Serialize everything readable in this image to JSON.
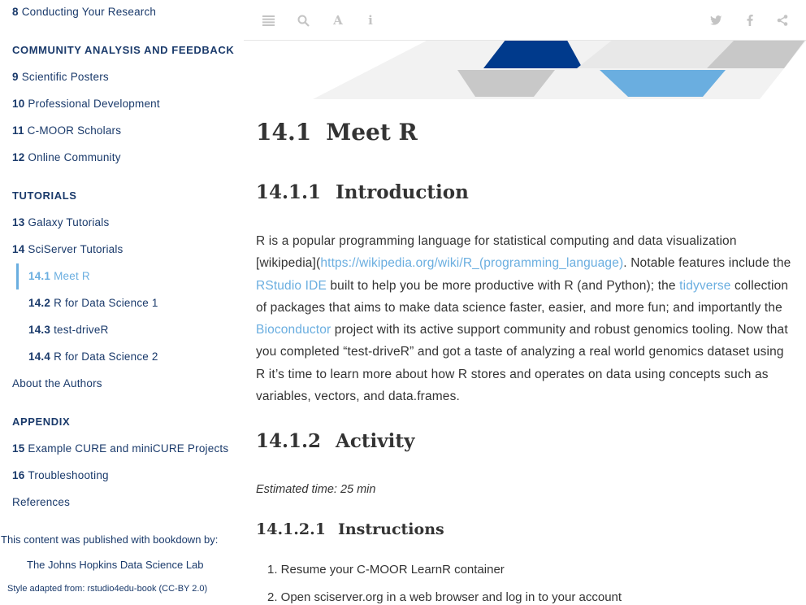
{
  "sidebar": {
    "items": [
      {
        "num": "8",
        "label": "Conducting Your Research"
      },
      {
        "section": "COMMUNITY ANALYSIS AND FEEDBACK"
      },
      {
        "num": "9",
        "label": "Scientific Posters"
      },
      {
        "num": "10",
        "label": "Professional Development"
      },
      {
        "num": "11",
        "label": "C-MOOR Scholars"
      },
      {
        "num": "12",
        "label": "Online Community"
      },
      {
        "section": "TUTORIALS"
      },
      {
        "num": "13",
        "label": "Galaxy Tutorials"
      },
      {
        "num": "14",
        "label": "SciServer Tutorials"
      },
      {
        "num": "14.1",
        "label": "Meet R"
      },
      {
        "num": "14.2",
        "label": "R for Data Science 1"
      },
      {
        "num": "14.3",
        "label": "test-driveR"
      },
      {
        "num": "14.4",
        "label": "R for Data Science 2"
      },
      {
        "label": "About the Authors"
      },
      {
        "section": "APPENDIX"
      },
      {
        "num": "15",
        "label": "Example CURE and miniCURE Projects"
      },
      {
        "num": "16",
        "label": "Troubleshooting"
      },
      {
        "label": "References"
      }
    ],
    "credits": {
      "published": "This content was published with bookdown by:",
      "lab": "The Johns Hopkins Data Science Lab",
      "style": "Style adapted from: rstudio4edu-book (CC-BY 2.0)"
    }
  },
  "toolbar": {
    "left_icons": [
      "toc-toggle-icon",
      "search-icon",
      "font-settings-icon",
      "info-icon"
    ],
    "right_icons": [
      "twitter-icon",
      "facebook-icon",
      "share-icon"
    ]
  },
  "content": {
    "title_num": "14.1",
    "title_text": "Meet R",
    "intro_num": "14.1.1",
    "intro_text": "Introduction",
    "para": {
      "p1": "R is a popular programming language for statistical computing and data visualization [wikipedia](",
      "link_wiki": "https://wikipedia.org/wiki/R_(programming_language)",
      "p2": ". Notable features include the ",
      "link_rstudio": "RStudio IDE",
      "p3": " built to help you be more productive with R (and Python); the ",
      "link_tidyverse": "tidyverse",
      "p4": " collection of packages that aims to make data science faster, easier, and more fun; and importantly the ",
      "link_bioc": "Bioconductor",
      "p5": " project with its active support community and robust genomics tooling. Now that you completed “test-driveR” and got a taste of analyzing a real world genomics dataset using R it’s time to learn more about how R stores and operates on data using concepts such as variables, vectors, and data.frames."
    },
    "activity_num": "14.1.2",
    "activity_text": "Activity",
    "estimated": "Estimated time: 25 min",
    "instr_num": "14.1.2.1",
    "instr_text": "Instructions",
    "list": [
      "1. Resume your C-MOOR LearnR container",
      "2. Open sciserver.org in a web browser and log in to your account"
    ]
  },
  "colors": {
    "brand_dark": "#003a8c",
    "brand_light": "#6aaee0",
    "gray": "#c8c8c8"
  }
}
